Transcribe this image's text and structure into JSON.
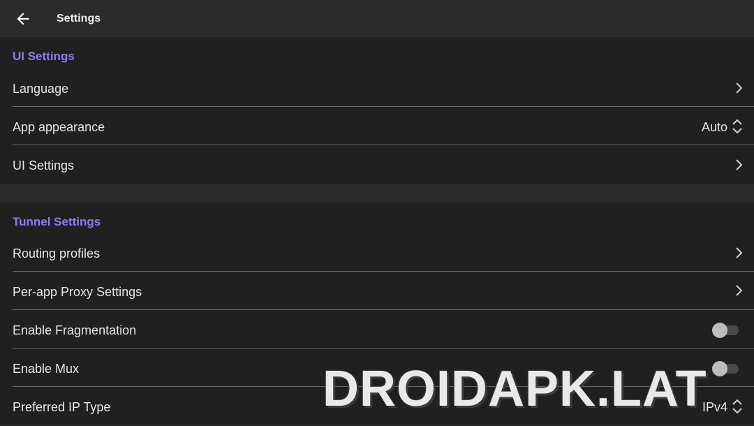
{
  "header": {
    "title": "Settings",
    "back_icon": "arrow-left-icon"
  },
  "sections": [
    {
      "title": "UI Settings",
      "items": [
        {
          "label": "Language",
          "control": "chevron"
        },
        {
          "label": "App appearance",
          "control": "select",
          "value": "Auto"
        },
        {
          "label": "UI Settings",
          "control": "chevron"
        }
      ]
    },
    {
      "title": "Tunnel Settings",
      "items": [
        {
          "label": "Routing profiles",
          "control": "chevron"
        },
        {
          "label": "Per-app Proxy Settings",
          "control": "chevron"
        },
        {
          "label": "Enable Fragmentation",
          "control": "toggle",
          "enabled": false
        },
        {
          "label": "Enable Mux",
          "control": "toggle",
          "enabled": false
        },
        {
          "label": "Preferred IP Type",
          "control": "select",
          "value": "IPv4"
        }
      ]
    }
  ],
  "watermark": "DROIDAPK.LAT",
  "colors": {
    "accent": "#8b7cf6",
    "background": "#202020",
    "header": "#2b2b2b"
  }
}
